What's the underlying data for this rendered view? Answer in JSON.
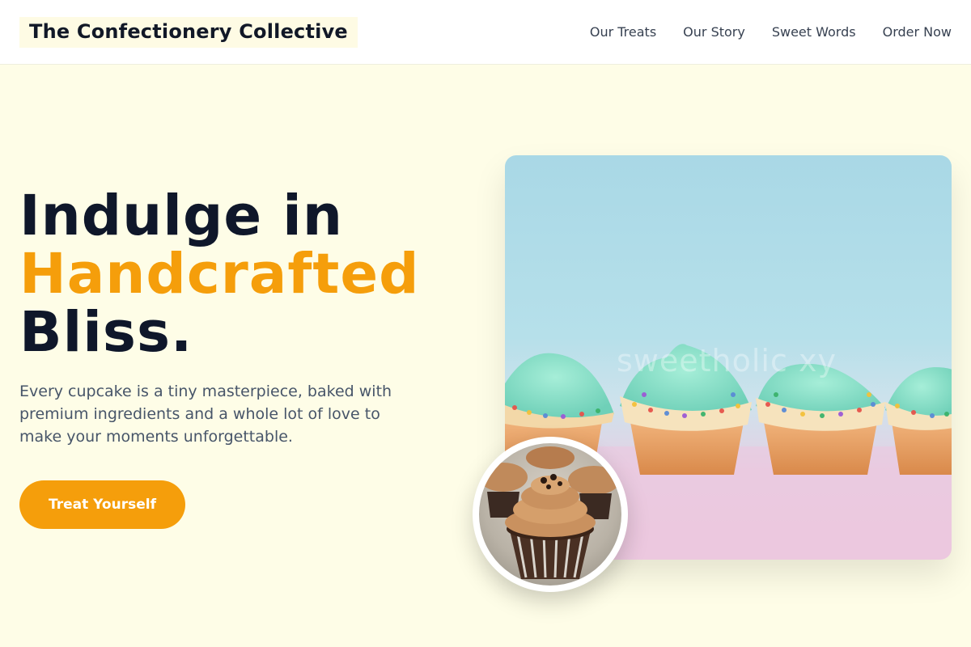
{
  "header": {
    "brand": "The Confectionery Collective",
    "nav": [
      "Our Treats",
      "Our Story",
      "Sweet Words",
      "Order Now"
    ]
  },
  "hero": {
    "headline_line1": "Indulge in",
    "headline_accent": "Handcrafted",
    "headline_line3": "Bliss.",
    "subtext": "Every cupcake is a tiny masterpiece, baked with premium ingredients and a whole lot of love to make your moments unforgettable.",
    "cta_label": "Treat Yourself",
    "image_watermark": "sweetholic xy"
  },
  "colors": {
    "accent": "#f59e0b",
    "heading": "#0f172a",
    "body_text": "#475569",
    "background": "#fefde7"
  }
}
